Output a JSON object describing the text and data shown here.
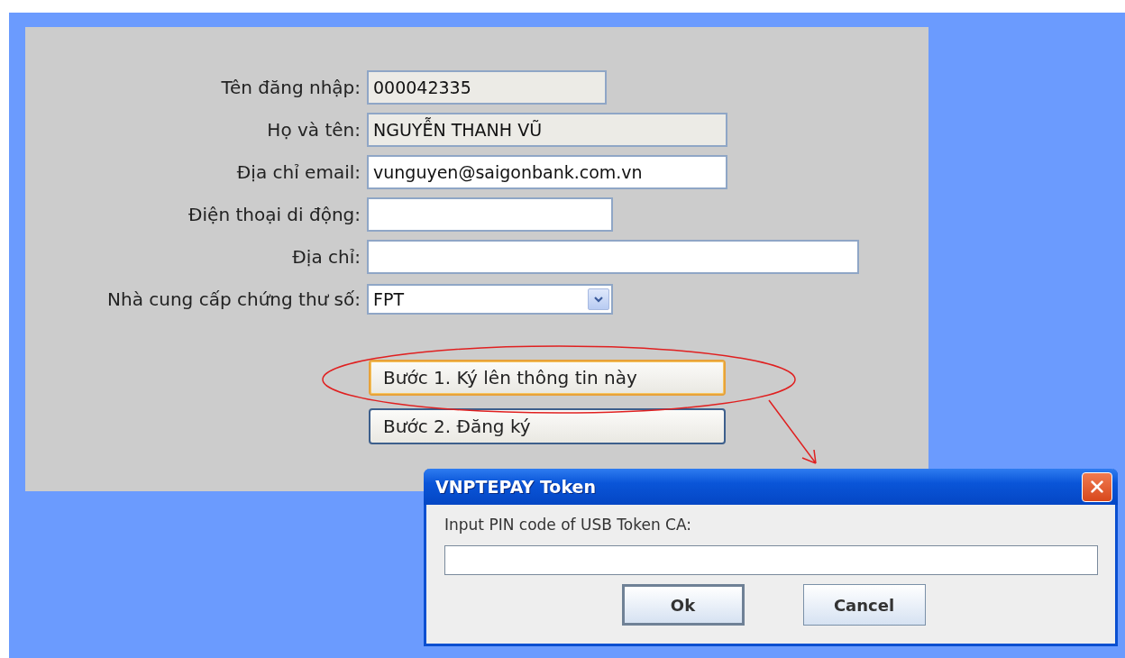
{
  "form": {
    "fields": [
      {
        "label": "Tên đăng nhập:",
        "kind": "text",
        "value": "000042335",
        "editable": false
      },
      {
        "label": "Họ và tên:",
        "kind": "text",
        "value": "NGUYỄN THANH VŨ",
        "editable": false
      },
      {
        "label": "Địa chỉ email:",
        "kind": "text",
        "value": "vunguyen@saigonbank.com.vn",
        "editable": true
      },
      {
        "label": "Điện thoại di động:",
        "kind": "text",
        "editable": true
      },
      {
        "label": "Địa chỉ:",
        "kind": "text",
        "editable": true
      },
      {
        "label": "Nhà cung cấp chứng thư số:",
        "kind": "select",
        "value": "FPT",
        "editable": true
      }
    ],
    "buttons": [
      {
        "label": "Bước 1. Ký lên thông tin này",
        "focused": true
      },
      {
        "label": "Bước 2. Đăng ký",
        "focused": false
      }
    ]
  },
  "dialog": {
    "title": "VNPTEPAY Token",
    "prompt": "Input PIN code of USB Token CA:",
    "buttons": [
      {
        "label": "Ok",
        "default": true
      },
      {
        "label": "Cancel",
        "default": false
      }
    ]
  }
}
